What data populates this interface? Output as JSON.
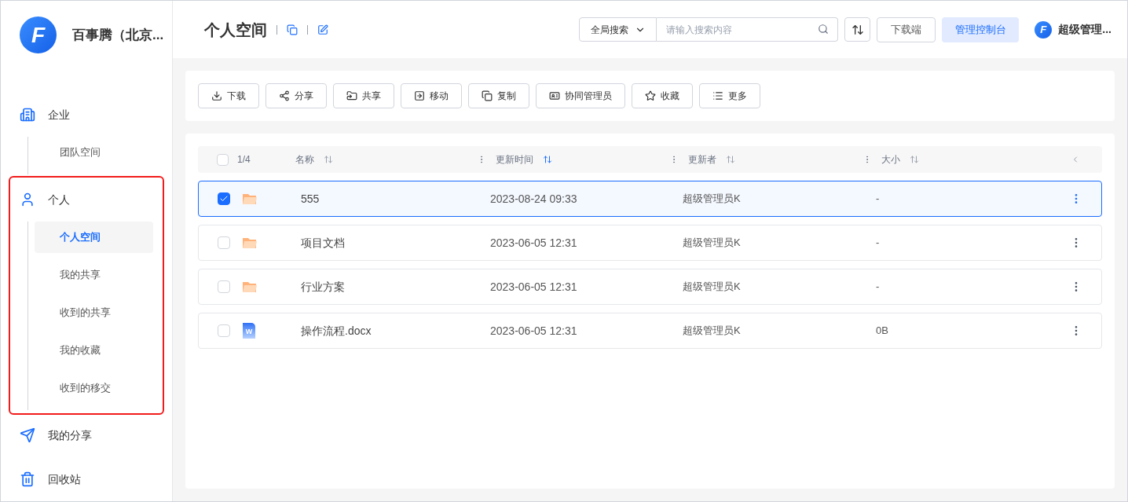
{
  "brand": {
    "logo_text": "F",
    "name": "百事腾（北京..."
  },
  "sidebar": [
    {
      "label": "企业",
      "highlighted": false,
      "children": [
        {
          "label": "团队空间",
          "selected": false
        }
      ]
    },
    {
      "label": "个人",
      "highlighted": true,
      "children": [
        {
          "label": "个人空间",
          "selected": true
        },
        {
          "label": "我的共享",
          "selected": false
        },
        {
          "label": "收到的共享",
          "selected": false
        },
        {
          "label": "我的收藏",
          "selected": false
        },
        {
          "label": "收到的移交",
          "selected": false
        }
      ]
    },
    {
      "label": "我的分享",
      "highlighted": false
    },
    {
      "label": "回收站",
      "highlighted": false
    }
  ],
  "header": {
    "title": "个人空间",
    "search_scope": "全局搜索",
    "search": {
      "placeholder": "请输入搜索内容"
    },
    "download_button": "下载端",
    "console_button": "管理控制台",
    "user": {
      "logo_text": "F",
      "name": "超级管理..."
    }
  },
  "toolbar": [
    {
      "label": "下载"
    },
    {
      "label": "分享"
    },
    {
      "label": "共享"
    },
    {
      "label": "移动"
    },
    {
      "label": "复制"
    },
    {
      "label": "协同管理员"
    },
    {
      "label": "收藏"
    },
    {
      "label": "更多"
    }
  ],
  "table": {
    "select_all": {
      "checked": false
    },
    "count": "1/4",
    "columns": [
      {
        "label": "名称",
        "sort_active": false
      },
      {
        "label": "更新时间",
        "sort_active": true
      },
      {
        "label": "更新者",
        "sort_active": false
      },
      {
        "label": "大小",
        "sort_active": false
      }
    ],
    "rows": [
      {
        "kind": "folder",
        "name": "555",
        "time": "2023-08-24 09:33",
        "updater": "超级管理员K",
        "size": "-",
        "selected": true
      },
      {
        "kind": "folder",
        "name": "项目文档",
        "time": "2023-06-05 12:31",
        "updater": "超级管理员K",
        "size": "-",
        "selected": false
      },
      {
        "kind": "folder",
        "name": "行业方案",
        "time": "2023-06-05 12:31",
        "updater": "超级管理员K",
        "size": "-",
        "selected": false
      },
      {
        "kind": "doc",
        "icon_text": "W",
        "name": "操作流程.docx",
        "time": "2023-06-05 12:31",
        "updater": "超级管理员K",
        "size": "0B",
        "selected": false
      }
    ]
  }
}
